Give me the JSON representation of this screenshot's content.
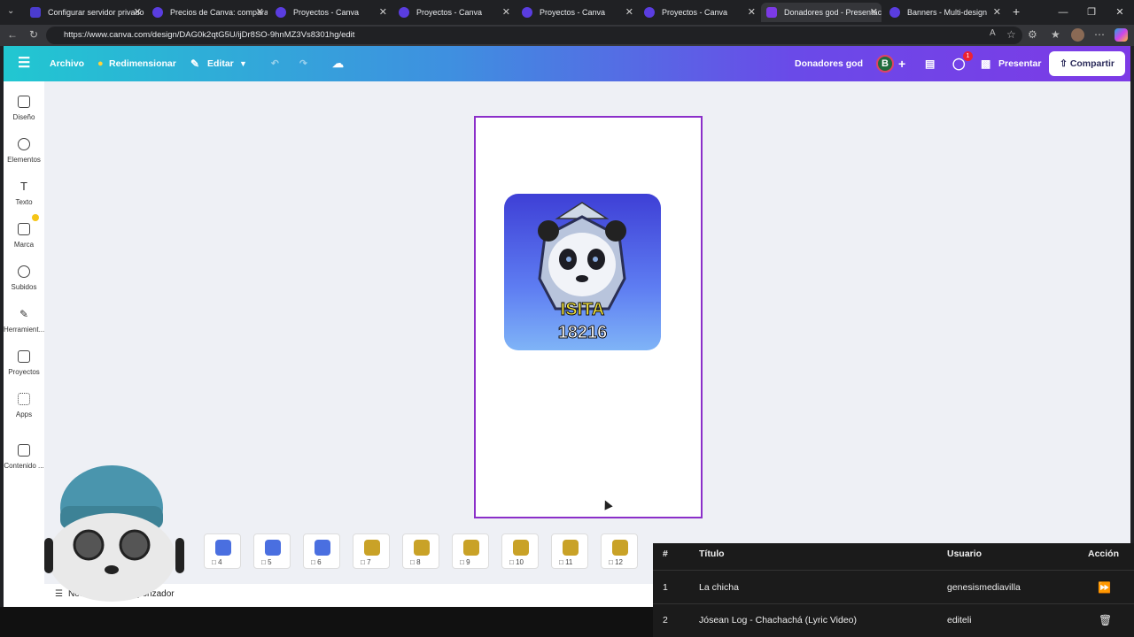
{
  "browser": {
    "tabs": [
      {
        "title": "Configurar servidor privado",
        "color": "#4b3ccf",
        "active": false
      },
      {
        "title": "Precios de Canva: compara l",
        "color": "#5a3de0",
        "active": false
      },
      {
        "title": "Proyectos - Canva",
        "color": "#5a3de0",
        "active": false
      },
      {
        "title": "Proyectos - Canva",
        "color": "#5a3de0",
        "active": false
      },
      {
        "title": "Proyectos - Canva",
        "color": "#5a3de0",
        "active": false
      },
      {
        "title": "Proyectos - Canva",
        "color": "#5a3de0",
        "active": false
      },
      {
        "title": "Donadores god - Presentaci",
        "color": "#7c3ae6",
        "active": true
      },
      {
        "title": "Banners - Multi-design",
        "color": "#5a3de0",
        "active": false
      }
    ],
    "url": "https://www.canva.com/design/DAG0k2qtG5U/ijDr8SO-9hnMZ3Vs8301hg/edit"
  },
  "header": {
    "archivo": "Archivo",
    "redimensionar": "Redimensionar",
    "editar": "Editar",
    "doc_title": "Donadores god",
    "avatar_initial": "B",
    "comment_count": "1",
    "presentar": "Presentar",
    "compartir": "Compartir"
  },
  "sidebar": {
    "items": [
      {
        "label": "Diseño",
        "icon": "layout-icon"
      },
      {
        "label": "Elementos",
        "icon": "shapes-icon"
      },
      {
        "label": "Texto",
        "icon": "text-icon"
      },
      {
        "label": "Marca",
        "icon": "brand-icon"
      },
      {
        "label": "Subidos",
        "icon": "upload-cloud-icon"
      },
      {
        "label": "Herramient...",
        "icon": "pen-tool-icon"
      },
      {
        "label": "Proyectos",
        "icon": "folder-icon"
      },
      {
        "label": "Apps",
        "icon": "apps-grid-icon"
      },
      {
        "label": "Contenido ...",
        "icon": "magic-media-icon"
      }
    ]
  },
  "canvas": {
    "card_name": "ISITA",
    "card_number": "18216"
  },
  "thumbnails": [
    "4",
    "5",
    "6",
    "7",
    "8",
    "9",
    "10",
    "11",
    "12"
  ],
  "thumb_colors": [
    "#4a6fe0",
    "#4a6fe0",
    "#4a6fe0",
    "#c9a227",
    "#c9a227",
    "#c9a227",
    "#c9a227",
    "#c9a227",
    "#c9a227"
  ],
  "bottom": {
    "notas": "Notas",
    "temporizador": "Temporizador"
  },
  "queue": {
    "headers": {
      "num": "#",
      "title": "Título",
      "user": "Usuario",
      "action": "Acción"
    },
    "rows": [
      {
        "num": "1",
        "title": "La chicha",
        "user": "genesismediavilla"
      },
      {
        "num": "2",
        "title": "Jósean Log - Chachachá (Lyric Video)",
        "user": "editeli"
      }
    ]
  }
}
